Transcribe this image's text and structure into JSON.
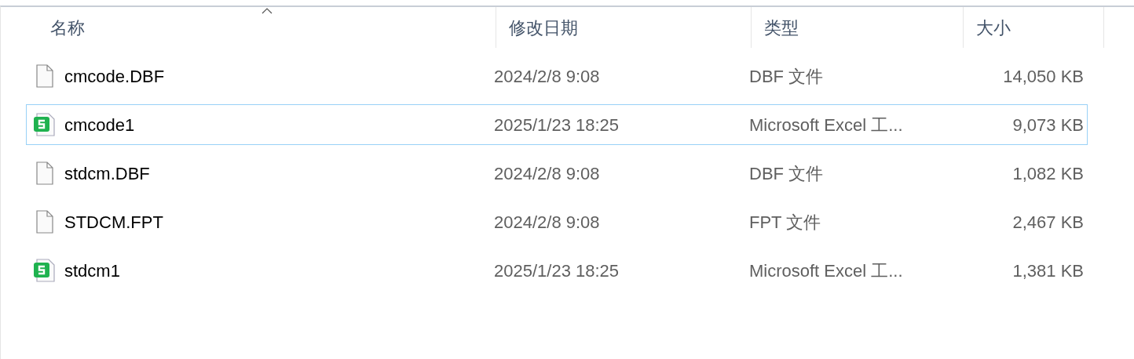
{
  "columns": [
    {
      "label": "名称",
      "sorted": true
    },
    {
      "label": "修改日期",
      "sorted": false
    },
    {
      "label": "类型",
      "sorted": false
    },
    {
      "label": "大小",
      "sorted": false
    }
  ],
  "rows": [
    {
      "kind": "file",
      "name": "cmcode.DBF",
      "date": "2024/2/8 9:08",
      "type": "DBF 文件",
      "size": "14,050 KB",
      "selected": false
    },
    {
      "kind": "spreadsheet",
      "name": "cmcode1",
      "date": "2025/1/23 18:25",
      "type": "Microsoft Excel 工...",
      "size": "9,073 KB",
      "selected": true
    },
    {
      "kind": "file",
      "name": "stdcm.DBF",
      "date": "2024/2/8 9:08",
      "type": "DBF 文件",
      "size": "1,082 KB",
      "selected": false
    },
    {
      "kind": "file",
      "name": "STDCM.FPT",
      "date": "2024/2/8 9:08",
      "type": "FPT 文件",
      "size": "2,467 KB",
      "selected": false
    },
    {
      "kind": "spreadsheet",
      "name": "stdcm1",
      "date": "2025/1/23 18:25",
      "type": "Microsoft Excel 工...",
      "size": "1,381 KB",
      "selected": false
    }
  ]
}
